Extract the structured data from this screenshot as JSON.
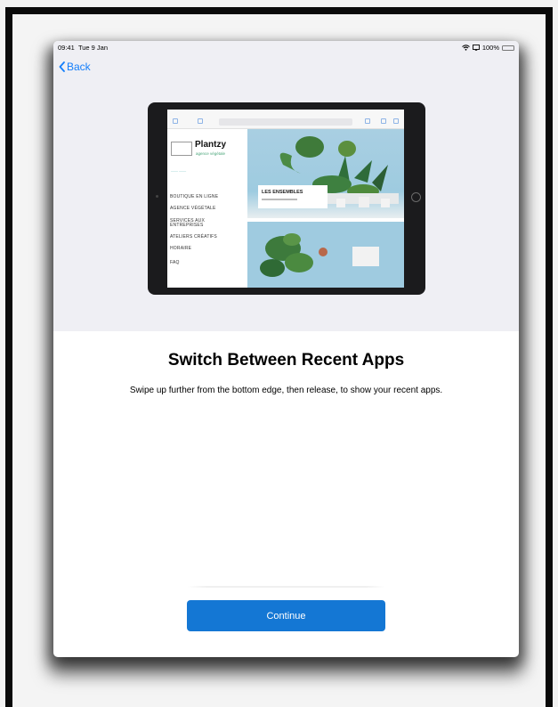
{
  "status_bar": {
    "time": "09:41",
    "date": "Tue 9 Jan",
    "battery": "100%",
    "battery_color": "#4cd964",
    "icons": [
      "wifi-icon",
      "screen-mirror-icon",
      "battery-icon"
    ]
  },
  "nav": {
    "back_label": "Back",
    "accent_color": "#147efb"
  },
  "preview": {
    "site_name": "Plantzy",
    "site_tagline": "agence végétale",
    "menu_items": [
      "BOUTIQUE EN LIGNE",
      "AGENCE VÉGÉTALE",
      "SERVICES AUX ENTREPRISES",
      "ATELIERS CRÉATIFS",
      "HORAIRE",
      "FAQ"
    ],
    "card_title": "LES ENSEMBLES"
  },
  "main": {
    "title": "Switch Between Recent Apps",
    "description": "Swipe up further from the bottom edge, then release, to show your recent apps."
  },
  "actions": {
    "continue_label": "Continue",
    "button_color": "#1477d4"
  }
}
